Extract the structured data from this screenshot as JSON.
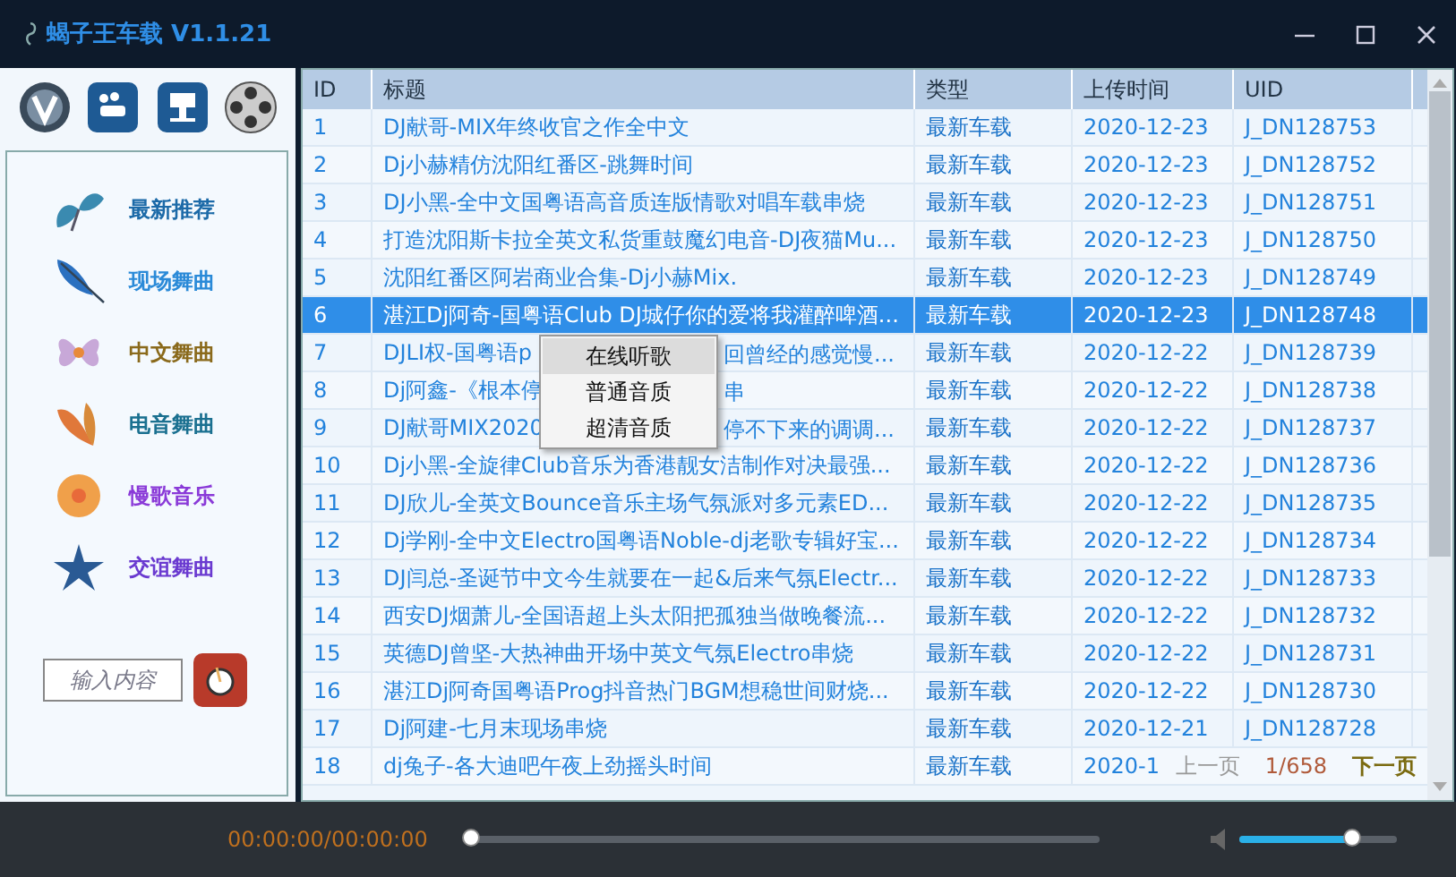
{
  "window": {
    "title": "蝎子王车载 V1.1.21"
  },
  "categories": [
    {
      "label": "最新推荐",
      "color": "#1c6aa8"
    },
    {
      "label": "现场舞曲",
      "color": "#2a8ad8"
    },
    {
      "label": "中文舞曲",
      "color": "#8a6a1c"
    },
    {
      "label": "电音舞曲",
      "color": "#1a7090"
    },
    {
      "label": "慢歌音乐",
      "color": "#8a3ad8"
    },
    {
      "label": "交谊舞曲",
      "color": "#6a3ad0"
    }
  ],
  "search": {
    "placeholder": "输入内容"
  },
  "table": {
    "columns": [
      "ID",
      "标题",
      "类型",
      "上传时间",
      "UID"
    ],
    "rows": [
      {
        "id": "1",
        "title": "DJ献哥-MIX年终收官之作全中文",
        "type": "最新车载",
        "date": "2020-12-23",
        "uid": "J_DN128753",
        "selected": false
      },
      {
        "id": "2",
        "title": "Dj小赫精仿沈阳红番区-跳舞时间",
        "type": "最新车载",
        "date": "2020-12-23",
        "uid": "J_DN128752",
        "selected": false
      },
      {
        "id": "3",
        "title": "DJ小黑-全中文国粤语高音质连版情歌对唱车载串烧",
        "type": "最新车载",
        "date": "2020-12-23",
        "uid": "J_DN128751",
        "selected": false
      },
      {
        "id": "4",
        "title": "打造沈阳斯卡拉全英文私货重鼓魔幻电音-DJ夜猫Mu...",
        "type": "最新车载",
        "date": "2020-12-23",
        "uid": "J_DN128750",
        "selected": false
      },
      {
        "id": "5",
        "title": "沈阳红番区阿岩商业合集-Dj小赫Mix.",
        "type": "最新车载",
        "date": "2020-12-23",
        "uid": "J_DN128749",
        "selected": false
      },
      {
        "id": "6",
        "title": "湛江Dj阿奇-国粤语Club DJ城仔你的爱将我灌醉啤酒...",
        "type": "最新车载",
        "date": "2020-12-23",
        "uid": "J_DN128748",
        "selected": true
      },
      {
        "id": "7",
        "title": "DJLI权-国粤语p",
        "title_tail": "回曾经的感觉慢...",
        "type": "最新车载",
        "date": "2020-12-22",
        "uid": "J_DN128739",
        "selected": false
      },
      {
        "id": "8",
        "title": "Dj阿鑫-《根本停",
        "title_tail": "串",
        "type": "最新车载",
        "date": "2020-12-22",
        "uid": "J_DN128738",
        "selected": false
      },
      {
        "id": "9",
        "title": "DJ献哥MIX2020",
        "title_tail": "停不下来的调调...",
        "type": "最新车载",
        "date": "2020-12-22",
        "uid": "J_DN128737",
        "selected": false
      },
      {
        "id": "10",
        "title": "Dj小黑-全旋律Club音乐为香港靓女洁制作对决最强...",
        "type": "最新车载",
        "date": "2020-12-22",
        "uid": "J_DN128736",
        "selected": false
      },
      {
        "id": "11",
        "title": "DJ欣儿-全英文Bounce音乐主场气氛派对多元素ED...",
        "type": "最新车载",
        "date": "2020-12-22",
        "uid": "J_DN128735",
        "selected": false
      },
      {
        "id": "12",
        "title": "Dj学刚-全中文Electro国粤语Noble-dj老歌专辑好宝...",
        "type": "最新车载",
        "date": "2020-12-22",
        "uid": "J_DN128734",
        "selected": false
      },
      {
        "id": "13",
        "title": "DJ闫总-圣诞节中文今生就要在一起&后来气氛Electr...",
        "type": "最新车载",
        "date": "2020-12-22",
        "uid": "J_DN128733",
        "selected": false
      },
      {
        "id": "14",
        "title": "西安DJ烟萧儿-全国语超上头太阳把孤独当做晚餐流...",
        "type": "最新车载",
        "date": "2020-12-22",
        "uid": "J_DN128732",
        "selected": false
      },
      {
        "id": "15",
        "title": "英德DJ曾坚-大热神曲开场中英文气氛Electro串烧",
        "type": "最新车载",
        "date": "2020-12-22",
        "uid": "J_DN128731",
        "selected": false
      },
      {
        "id": "16",
        "title": "湛江Dj阿奇国粤语Prog抖音热门BGM想稳世间财烧...",
        "type": "最新车载",
        "date": "2020-12-22",
        "uid": "J_DN128730",
        "selected": false
      },
      {
        "id": "17",
        "title": "Dj阿建-七月末现场串烧",
        "type": "最新车载",
        "date": "2020-12-21",
        "uid": "J_DN128728",
        "selected": false
      },
      {
        "id": "18",
        "title": "dj兔子-各大迪吧午夜上劲摇头时间",
        "type": "最新车载",
        "date": "2020-1",
        "selected": false
      }
    ]
  },
  "pager": {
    "prev": "上一页",
    "page": "1/658",
    "next": "下一页"
  },
  "context_menu": [
    {
      "label": "在线听歌",
      "selected": true
    },
    {
      "label": "普通音质",
      "selected": false
    },
    {
      "label": "超清音质",
      "selected": false
    }
  ],
  "player": {
    "time": "00:00:00/00:00:00",
    "progress": {
      "level": 0.01
    },
    "volume": {
      "level": 0.72
    }
  }
}
